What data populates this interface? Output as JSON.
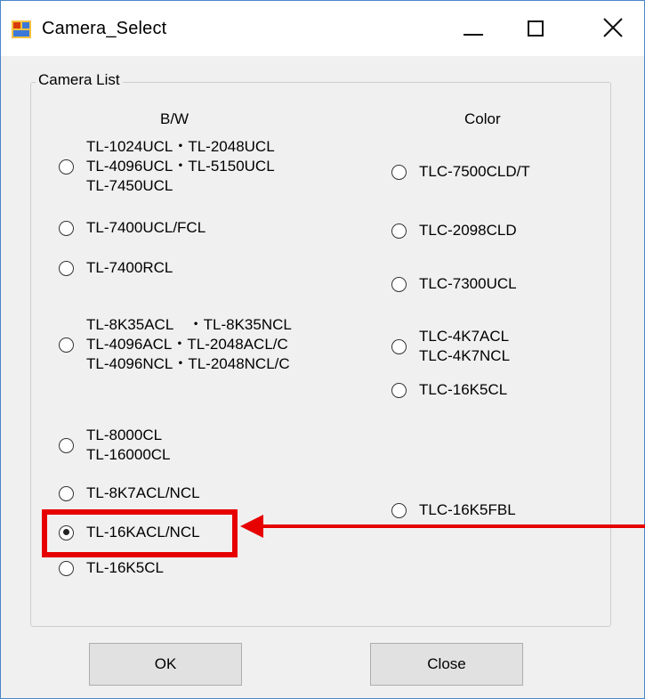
{
  "window": {
    "title": "Camera_Select",
    "icon": "app-window-icon",
    "controls": [
      "minimize-icon",
      "maximize-icon",
      "close-icon"
    ]
  },
  "group": {
    "legend": "Camera List",
    "bw_header": "B/W",
    "color_header": "Color"
  },
  "bw_options": [
    {
      "label": "TL-1024UCL・TL-2048UCL\nTL-4096UCL・TL-5150UCL\nTL-7450UCL",
      "checked": false
    },
    {
      "label": "TL-7400UCL/FCL",
      "checked": false
    },
    {
      "label": "TL-7400RCL",
      "checked": false
    },
    {
      "label": "TL-8K35ACL　・TL-8K35NCL\nTL-4096ACL・TL-2048ACL/C\nTL-4096NCL・TL-2048NCL/C",
      "checked": false
    },
    {
      "label": "TL-8000CL\nTL-16000CL",
      "checked": false
    },
    {
      "label": "TL-8K7ACL/NCL",
      "checked": false
    },
    {
      "label": "TL-16KACL/NCL",
      "checked": true
    },
    {
      "label": "TL-16K5CL",
      "checked": false
    }
  ],
  "color_options": [
    {
      "label": "TLC-7500CLD/T",
      "checked": false
    },
    {
      "label": "TLC-2098CLD",
      "checked": false
    },
    {
      "label": "TLC-7300UCL",
      "checked": false
    },
    {
      "label": "TLC-4K7ACL\nTLC-4K7NCL",
      "checked": false
    },
    {
      "label": "TLC-16K5CL",
      "checked": false
    },
    {
      "label": "TLC-16K5FBL",
      "checked": false
    }
  ],
  "buttons": {
    "ok": "OK",
    "close": "Close"
  },
  "annotation": {
    "color": "#e60000",
    "target": "TL-16KACL/NCL"
  }
}
